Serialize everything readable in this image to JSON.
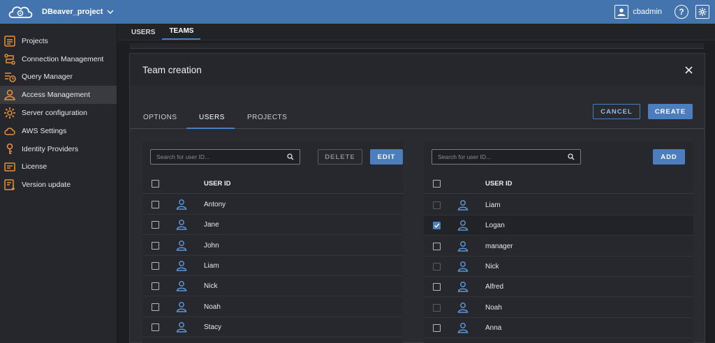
{
  "topbar": {
    "project_name": "DBeaver_project",
    "username": "cbadmin",
    "help_label": "?"
  },
  "sidebar": {
    "items": [
      {
        "label": "Projects",
        "icon": "projects-icon"
      },
      {
        "label": "Connection Management",
        "icon": "connection-icon"
      },
      {
        "label": "Query Manager",
        "icon": "query-manager-icon"
      },
      {
        "label": "Access Management",
        "icon": "access-icon",
        "active": true
      },
      {
        "label": "Server configuration",
        "icon": "server-config-icon"
      },
      {
        "label": "AWS Settings",
        "icon": "cloud-icon"
      },
      {
        "label": "Identity Providers",
        "icon": "key-icon"
      },
      {
        "label": "License",
        "icon": "license-icon"
      },
      {
        "label": "Version update",
        "icon": "version-update-icon"
      }
    ]
  },
  "main": {
    "tabs": [
      {
        "label": "USERS"
      },
      {
        "label": "TEAMS",
        "active": true
      }
    ]
  },
  "dialog": {
    "title": "Team creation",
    "tabs": [
      {
        "label": "OPTIONS"
      },
      {
        "label": "USERS",
        "active": true
      },
      {
        "label": "PROJECTS"
      }
    ],
    "cancel_label": "CANCEL",
    "create_label": "CREATE",
    "left_panel": {
      "search_placeholder": "Search for user ID...",
      "delete_label": "DELETE",
      "edit_label": "EDIT",
      "column_header": "USER ID",
      "rows": [
        {
          "name": "Antony",
          "checked": false
        },
        {
          "name": "Jane",
          "checked": false
        },
        {
          "name": "John",
          "checked": false
        },
        {
          "name": "Liam",
          "checked": false
        },
        {
          "name": "Nick",
          "checked": false
        },
        {
          "name": "Noah",
          "checked": false
        },
        {
          "name": "Stacy",
          "checked": false
        }
      ]
    },
    "right_panel": {
      "search_placeholder": "Search for user ID...",
      "add_label": "ADD",
      "column_header": "USER ID",
      "rows": [
        {
          "name": "Liam",
          "checked": false,
          "disabled": true
        },
        {
          "name": "Logan",
          "checked": true,
          "disabled": false
        },
        {
          "name": "manager",
          "checked": false,
          "disabled": false
        },
        {
          "name": "Nick",
          "checked": false,
          "disabled": true
        },
        {
          "name": "Alfred",
          "checked": false,
          "disabled": false
        },
        {
          "name": "Noah",
          "checked": false,
          "disabled": true
        },
        {
          "name": "Anna",
          "checked": false,
          "disabled": false
        }
      ]
    }
  },
  "colors": {
    "accent": "#4c7ebd",
    "topbar": "#4474ad",
    "sidebar_icon": "#e8913a",
    "user_icon": "#5b95d6"
  }
}
